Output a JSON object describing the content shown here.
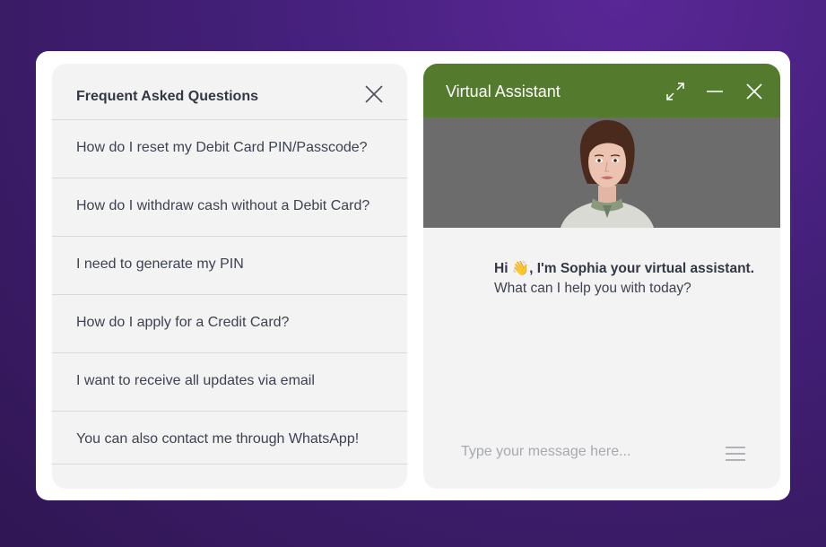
{
  "faq": {
    "title": "Frequent Asked Questions",
    "items": [
      {
        "label": "How do I reset my Debit Card PIN/Passcode?"
      },
      {
        "label": "How do I withdraw cash without a Debit Card?"
      },
      {
        "label": "I need to generate my PIN"
      },
      {
        "label": "How do I apply for a Credit Card?"
      },
      {
        "label": "I want to receive all updates via email"
      },
      {
        "label": "You can also contact me through WhatsApp!"
      }
    ]
  },
  "assistant": {
    "title": "Virtual Assistant",
    "header_color": "#547a2e",
    "greeting_prefix": "Hi ",
    "greeting_emoji": "👋",
    "greeting_bold": ", I'm Sophia your virtual assistant.",
    "greeting_line2": "What can I help you with today?",
    "input_placeholder": "Type your message here..."
  },
  "icons": {
    "faq_close": "close-icon",
    "expand": "expand-icon",
    "minimize": "minimize-icon",
    "close": "close-icon",
    "menu": "menu-icon"
  }
}
